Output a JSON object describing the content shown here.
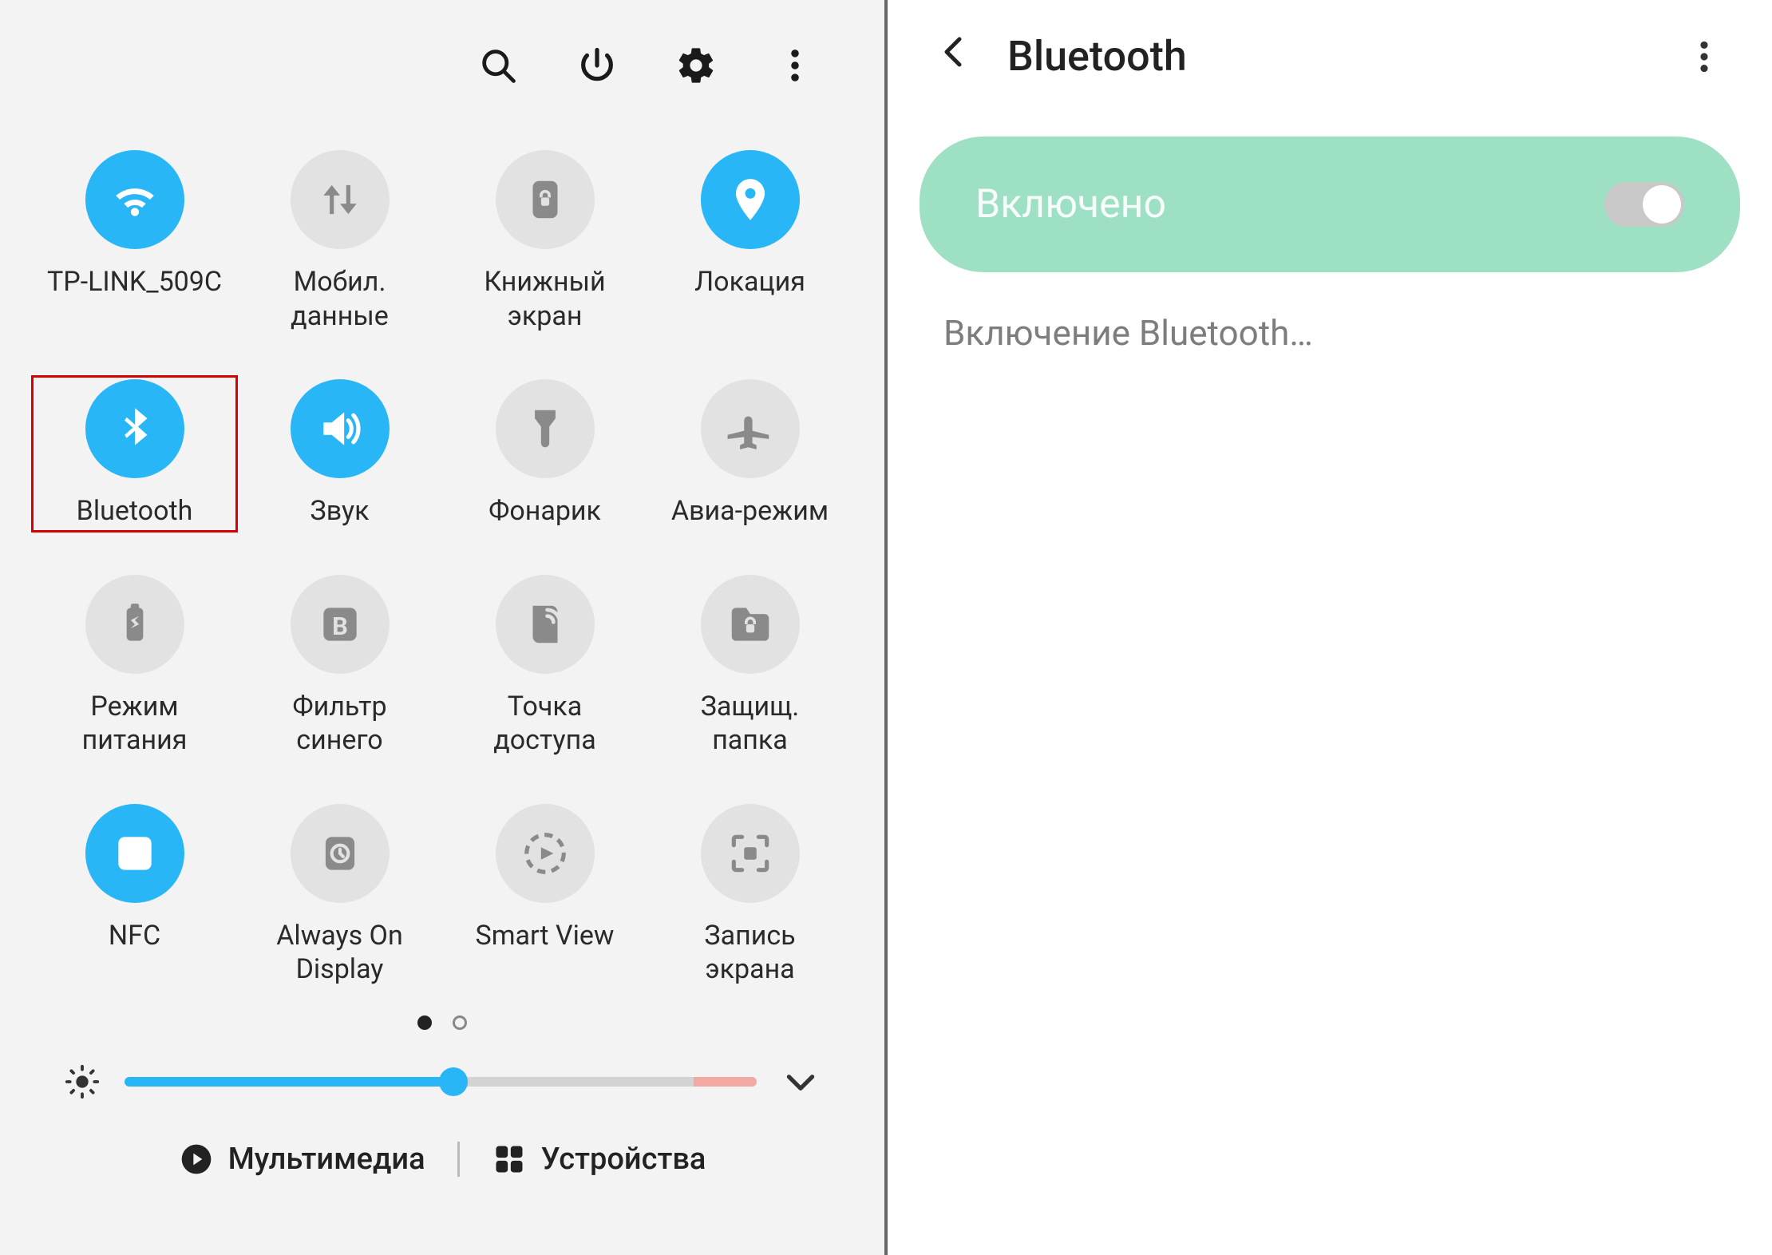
{
  "left": {
    "toolbar": {
      "search": "search-icon",
      "power": "power-icon",
      "settings": "gear-icon",
      "more": "more-vert-icon"
    },
    "tiles": [
      {
        "id": "wifi",
        "label": "TP-LINK_509C",
        "on": true,
        "icon": "wifi",
        "highlight": false
      },
      {
        "id": "mobile-data",
        "label": "Мобил. данные",
        "on": false,
        "icon": "updown",
        "highlight": false
      },
      {
        "id": "book-screen",
        "label": "Книжный экран",
        "on": false,
        "icon": "lock-portrait",
        "highlight": false
      },
      {
        "id": "location",
        "label": "Локация",
        "on": true,
        "icon": "location",
        "highlight": false
      },
      {
        "id": "bluetooth",
        "label": "Bluetooth",
        "on": true,
        "icon": "bluetooth",
        "highlight": true
      },
      {
        "id": "sound",
        "label": "Звук",
        "on": true,
        "icon": "speaker",
        "highlight": false
      },
      {
        "id": "flashlight",
        "label": "Фонарик",
        "on": false,
        "icon": "flashlight",
        "highlight": false
      },
      {
        "id": "airplane",
        "label": "Авиа-режим",
        "on": false,
        "icon": "airplane",
        "highlight": false
      },
      {
        "id": "power-mode",
        "label": "Режим питания",
        "on": false,
        "icon": "battery-eco",
        "highlight": false
      },
      {
        "id": "blue-filter",
        "label": "Фильтр синего",
        "on": false,
        "icon": "letter-b",
        "highlight": false
      },
      {
        "id": "hotspot",
        "label": "Точка доступа",
        "on": false,
        "icon": "hotspot",
        "highlight": false
      },
      {
        "id": "secure-folder",
        "label": "Защищ. папка",
        "on": false,
        "icon": "folder-lock",
        "highlight": false
      },
      {
        "id": "nfc",
        "label": "NFC",
        "on": true,
        "icon": "nfc",
        "highlight": false
      },
      {
        "id": "aod",
        "label": "Always On Display",
        "on": false,
        "icon": "clock-panel",
        "highlight": false
      },
      {
        "id": "smart-view",
        "label": "Smart View",
        "on": false,
        "icon": "cast",
        "highlight": false
      },
      {
        "id": "screen-rec",
        "label": "Запись экрана",
        "on": false,
        "icon": "rec-frame",
        "highlight": false
      }
    ],
    "pagination": {
      "pages": 2,
      "current": 1
    },
    "brightness": {
      "value_pct": 52
    },
    "bottom": {
      "multimedia": "Мультимедиа",
      "devices": "Устройства"
    }
  },
  "right": {
    "title": "Bluetooth",
    "banner_label": "Включено",
    "switch_on": true,
    "status_text": "Включение Bluetooth…"
  }
}
